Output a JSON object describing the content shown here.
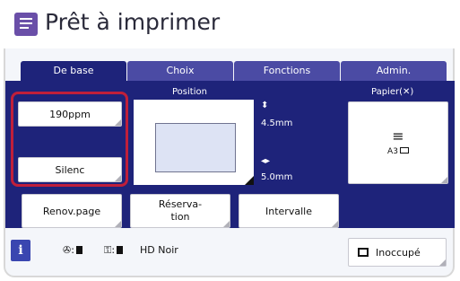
{
  "header": {
    "title": "Prêt à imprimer",
    "icon": "document-list-icon"
  },
  "tabs": [
    {
      "label": "De base",
      "active": true
    },
    {
      "label": "Choix",
      "active": false
    },
    {
      "label": "Fonctions",
      "active": false
    },
    {
      "label": "Admin.",
      "active": false
    }
  ],
  "position": {
    "label": "Position",
    "vertical_offset": "4.5mm",
    "horizontal_offset": "5.0mm"
  },
  "left_buttons": {
    "speed": "190ppm",
    "mode": "Silenc"
  },
  "paper": {
    "label": "Papier(",
    "size": "A3"
  },
  "actions": {
    "renov": "Renov.page",
    "reservation": "Réserva-\ntion",
    "intervalle": "Intervalle"
  },
  "status": {
    "color_mode": "HD Noir",
    "busy": "Inoccupé"
  },
  "colors": {
    "accent": "#1e237a",
    "tab_inactive": "#4b4ba4",
    "highlight": "#c01f3a",
    "header_icon": "#6a4fa8"
  }
}
